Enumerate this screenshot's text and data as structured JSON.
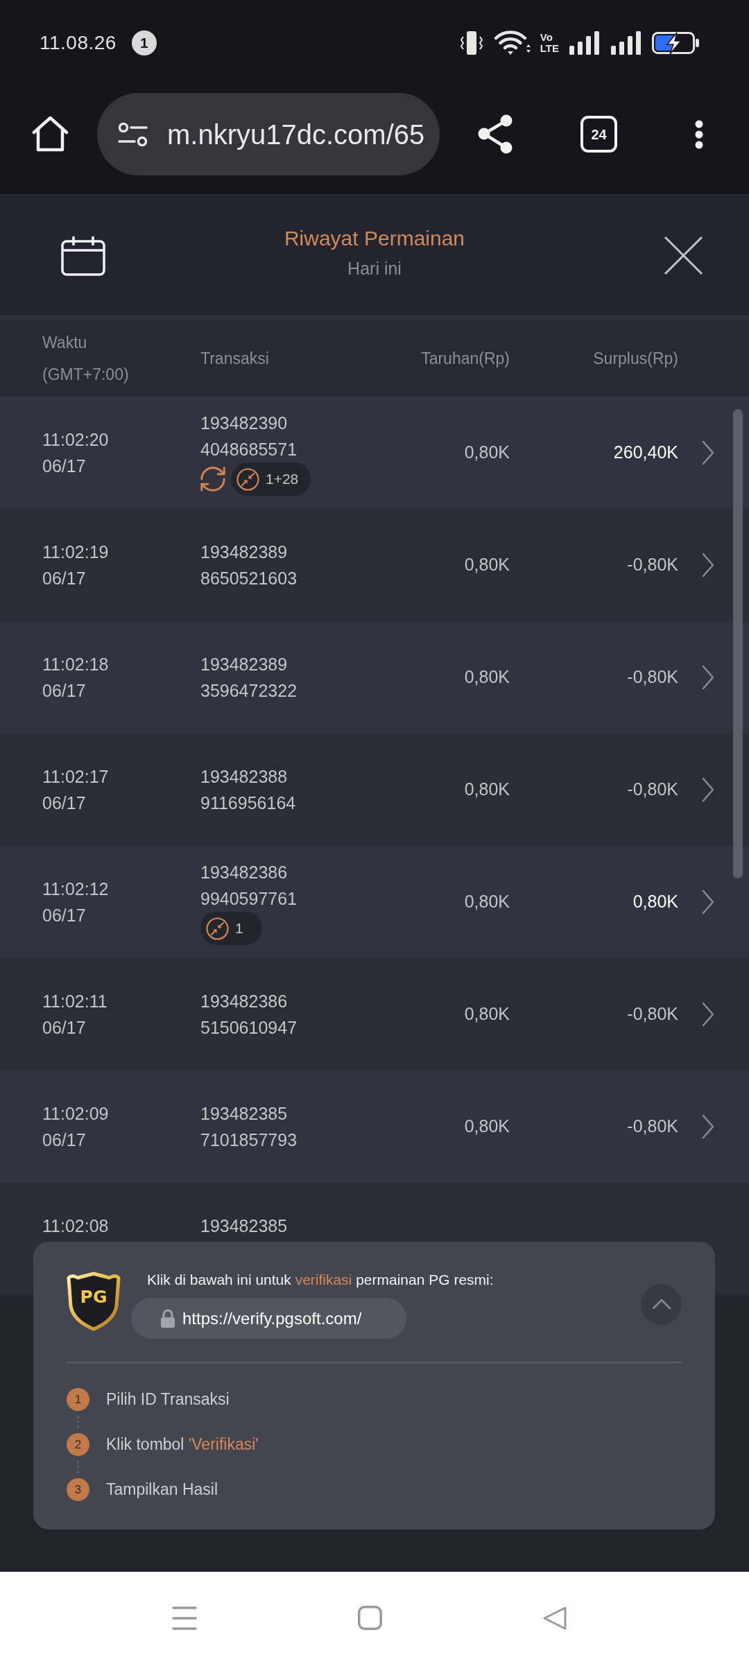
{
  "status_bar": {
    "time": "11.08.26",
    "notification_count": "1",
    "network_label": [
      "Vo",
      "LTE"
    ]
  },
  "browser": {
    "url": "m.nkryu17dc.com/65",
    "tab_count": "24"
  },
  "header": {
    "title": "Riwayat Permainan",
    "subtitle": "Hari ini"
  },
  "table": {
    "columns": [
      {
        "lines": [
          "Waktu",
          "(GMT+7:00)"
        ]
      },
      {
        "lines": [
          "Transaksi"
        ]
      },
      {
        "lines": [
          "Taruhan(Rp)"
        ]
      },
      {
        "lines": [
          "Surplus(Rp)"
        ]
      }
    ],
    "rows": [
      {
        "time": "11:02:20",
        "date": "06/17",
        "transaction": [
          "193482390",
          "4048685571"
        ],
        "tags": [
          {
            "kind": "cycle"
          },
          {
            "kind": "counter",
            "label": "1+28"
          }
        ],
        "bet": "0,80K",
        "surplus": "260,40K",
        "win": true
      },
      {
        "time": "11:02:19",
        "date": "06/17",
        "transaction": [
          "193482389",
          "8650521603"
        ],
        "bet": "0,80K",
        "surplus": "-0,80K",
        "win": false
      },
      {
        "time": "11:02:18",
        "date": "06/17",
        "transaction": [
          "193482389",
          "3596472322"
        ],
        "bet": "0,80K",
        "surplus": "-0,80K",
        "win": false
      },
      {
        "time": "11:02:17",
        "date": "06/17",
        "transaction": [
          "193482388",
          "9116956164"
        ],
        "bet": "0,80K",
        "surplus": "-0,80K",
        "win": false
      },
      {
        "time": "11:02:12",
        "date": "06/17",
        "transaction": [
          "193482386",
          "9940597761"
        ],
        "tags": [
          {
            "kind": "counter",
            "label": "1"
          }
        ],
        "bet": "0,80K",
        "surplus": "0,80K",
        "win": true
      },
      {
        "time": "11:02:11",
        "date": "06/17",
        "transaction": [
          "193482386",
          "5150610947"
        ],
        "bet": "0,80K",
        "surplus": "-0,80K",
        "win": false
      },
      {
        "time": "11:02:09",
        "date": "06/17",
        "transaction": [
          "193482385",
          "7101857793"
        ],
        "bet": "0,80K",
        "surplus": "-0,80K",
        "win": false
      },
      {
        "time": "11:02:08",
        "transaction": [
          "193482385"
        ]
      }
    ]
  },
  "verify_panel": {
    "logo": "PG",
    "intro": [
      {
        "text": "Klik di bawah ini untuk ",
        "highlight": false
      },
      {
        "text": "verifikasi",
        "highlight": true
      },
      {
        "text": " permainan PG resmi:",
        "highlight": false
      }
    ],
    "url": "https://verify.pgsoft.com/",
    "steps": [
      {
        "number": "1",
        "parts": [
          {
            "text": "Pilih ID Transaksi",
            "highlight": false
          }
        ]
      },
      {
        "number": "2",
        "parts": [
          {
            "text": "Klik tombol ",
            "highlight": false
          },
          {
            "text": "'Verifikasi'",
            "highlight": true
          }
        ]
      },
      {
        "number": "3",
        "parts": [
          {
            "text": "Tampilkan Hasil",
            "highlight": false
          }
        ]
      }
    ]
  }
}
